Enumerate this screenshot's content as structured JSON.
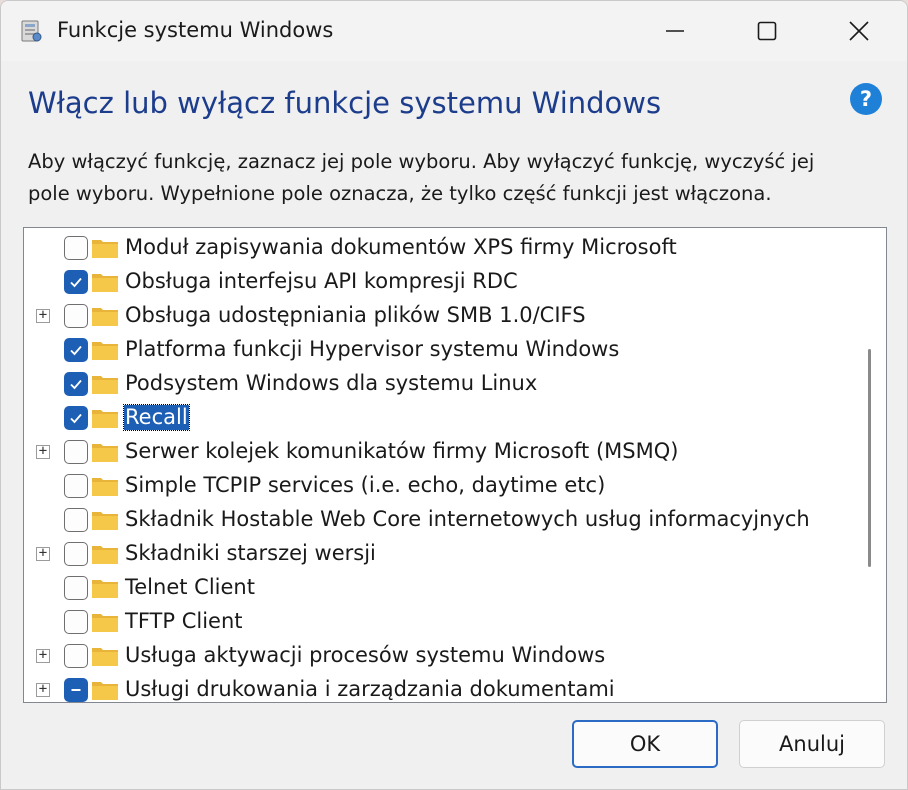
{
  "window": {
    "title": "Funkcje systemu Windows",
    "heading": "Włącz lub wyłącz funkcje systemu Windows",
    "description_lines": [
      "Aby włączyć funkcję, zaznacz jej pole wyboru. Aby wyłączyć funkcję, wyczyść jej",
      "pole wyboru. Wypełnione pole oznacza, że tylko część funkcji jest włączona."
    ],
    "help_glyph": "?"
  },
  "features": [
    {
      "label": "Moduł zapisywania dokumentów XPS firmy Microsoft",
      "state": "unchecked",
      "expandable": false
    },
    {
      "label": "Obsługa interfejsu API kompresji RDC",
      "state": "checked",
      "expandable": false
    },
    {
      "label": "Obsługa udostępniania plików SMB 1.0/CIFS",
      "state": "unchecked",
      "expandable": true
    },
    {
      "label": "Platforma funkcji Hypervisor systemu Windows",
      "state": "checked",
      "expandable": false
    },
    {
      "label": "Podsystem Windows dla systemu Linux",
      "state": "checked",
      "expandable": false
    },
    {
      "label": "Recall",
      "state": "checked",
      "expandable": false,
      "selected": true
    },
    {
      "label": "Serwer kolejek komunikatów firmy Microsoft (MSMQ)",
      "state": "unchecked",
      "expandable": true
    },
    {
      "label": "Simple TCPIP services (i.e. echo, daytime etc)",
      "state": "unchecked",
      "expandable": false
    },
    {
      "label": "Składnik Hostable Web Core internetowych usług informacyjnych",
      "state": "unchecked",
      "expandable": false
    },
    {
      "label": "Składniki starszej wersji",
      "state": "unchecked",
      "expandable": true
    },
    {
      "label": "Telnet Client",
      "state": "unchecked",
      "expandable": false
    },
    {
      "label": "TFTP Client",
      "state": "unchecked",
      "expandable": false
    },
    {
      "label": "Usługa aktywacji procesów systemu Windows",
      "state": "unchecked",
      "expandable": true
    },
    {
      "label": "Usługi drukowania i zarządzania dokumentami",
      "state": "partial",
      "expandable": true
    }
  ],
  "buttons": {
    "ok": "OK",
    "cancel": "Anuluj"
  },
  "colors": {
    "heading": "#1c3c8c",
    "checkbox_accent": "#1d5fb5",
    "folder": "#f6c84a",
    "ok_border": "#2b6bc6"
  }
}
